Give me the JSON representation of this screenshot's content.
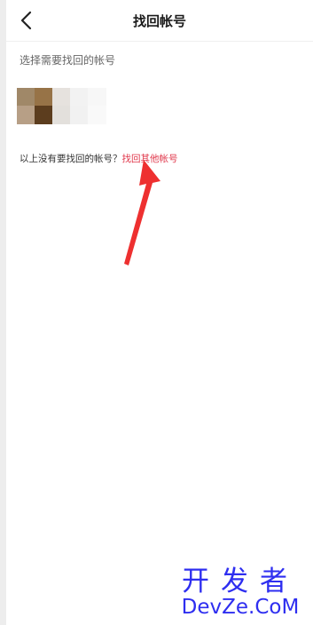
{
  "header": {
    "title": "找回帐号",
    "back_icon": "chevron-left-icon"
  },
  "main": {
    "section_label": "选择需要找回的帐号",
    "account": {
      "avatar": "blurred-avatar"
    },
    "prompt_text": "以上没有要找回的帐号？",
    "retrieve_link": "找回其他帐号",
    "annotation": "red-arrow"
  },
  "watermark": {
    "chinese": "开发者",
    "latin": "DevZe.CoM"
  },
  "colors": {
    "link": "#e0364a",
    "arrow": "#ee3030",
    "watermark": "#2e2ef0",
    "title": "#1a1a1a",
    "label": "#666666"
  }
}
